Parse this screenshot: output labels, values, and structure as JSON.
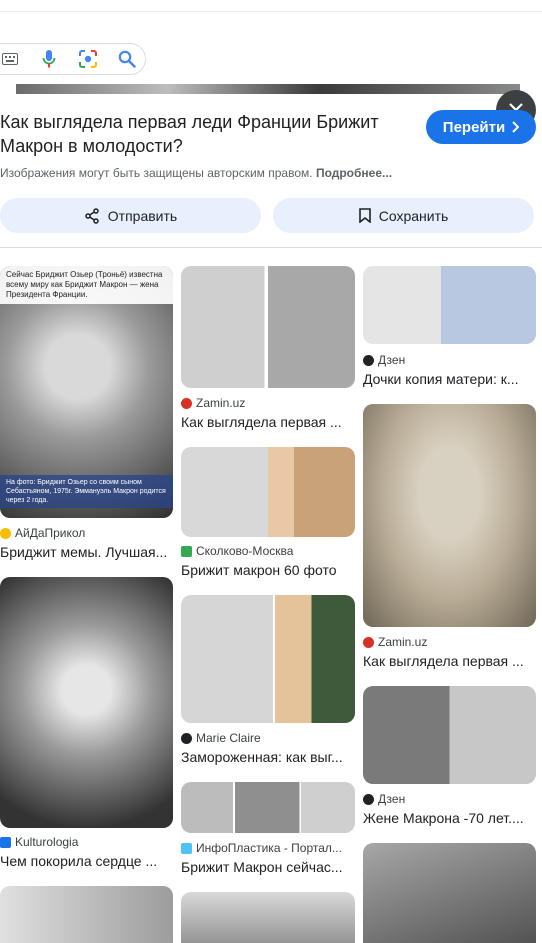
{
  "header": {
    "close_label": "Закрыть"
  },
  "detail": {
    "title": "Как выглядела первая леди Франции Брижит Макрон в молодости?",
    "visit_label": "Перейти",
    "notice": "Изображения могут быть защищены авторским правом.",
    "notice_more": "Подробнее...",
    "share_label": "Отправить",
    "save_label": "Сохранить"
  },
  "results": [
    {
      "source": "АйДаПрикол",
      "caption": "Бриджит мемы. Лучшая...",
      "overlay_top": "Сейчас Бриджит Озьер (Троньё) известна всему миру как Бриджит Макрон — жена Президента Франции.",
      "overlay_bottom": "На фото: Бриджит Озьер со своим сыном Себастьяном, 1975г. Эммануэль Макрон родится через 2 года.",
      "fav_color": "#fbbc04"
    },
    {
      "source": "Kulturologia",
      "caption": "Чем покорила сердце ...",
      "fav_color": "#1a73e8"
    },
    {
      "source": "Zamin.uz",
      "caption": "Как выглядела первая ...",
      "fav_color": "#d93025"
    },
    {
      "source": "Сколково-Москва",
      "caption": "Брижит макрон 60 фото",
      "fav_color": "#34a853"
    },
    {
      "source": "Marie Claire",
      "caption": "Замороженная: как выг...",
      "fav_color": "#202124"
    },
    {
      "source": "ИнфоПластика - Портал...",
      "caption": "Брижит Макрон сейчас...",
      "fav_color": "#4fc3f7"
    },
    {
      "source": "Дзен",
      "caption": "Дочки копия матери: к...",
      "fav_color": "#202124"
    },
    {
      "source": "Zamin.uz",
      "caption": "Как выглядела первая ...",
      "fav_color": "#d93025"
    },
    {
      "source": "Дзен",
      "caption": "Жене Макрона -70 лет....",
      "fav_color": "#202124"
    }
  ]
}
